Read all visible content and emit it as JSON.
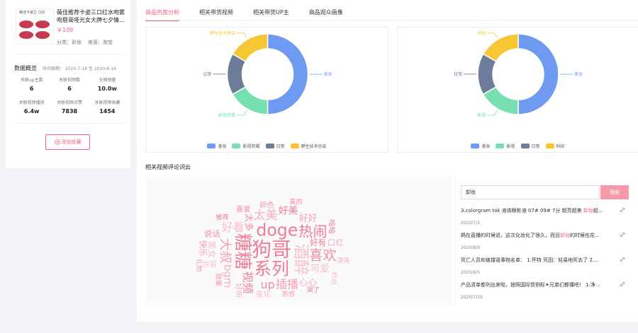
{
  "product": {
    "title": "薇佳推荐卡姿三口红水吻雾吻唇膏哑光女大牌七夕情…",
    "price": "￥109",
    "category_label": "分类：",
    "category": "彩妆",
    "source_label": "来源：",
    "source": "淘宝",
    "thumb_caption": "薇佳卡姿兰 口红"
  },
  "stats": {
    "title": "数据概览",
    "range_label": "时间周期：",
    "range_start": "2020-7-18",
    "range_sep": "至",
    "range_end": "2020-8-16",
    "items": [
      {
        "label": "关联up主数",
        "value": "6"
      },
      {
        "label": "关联视频数",
        "value": "6"
      },
      {
        "label": "全网销量",
        "value": "10.0w"
      },
      {
        "label": "关联视频播放",
        "value": "6.4w"
      },
      {
        "label": "关联视频点赞",
        "value": "7838"
      },
      {
        "label": "关联视频收藏",
        "value": "1454"
      }
    ]
  },
  "favorite_button": {
    "icon": "plus-circle-icon",
    "label": "添加收藏"
  },
  "tabs": [
    {
      "label": "商品热度分析",
      "active": true
    },
    {
      "label": "相关带货视频",
      "active": false
    },
    {
      "label": "相关带货UP主",
      "active": false
    },
    {
      "label": "商品观众画像",
      "active": false
    }
  ],
  "charts": [
    {
      "type": "donut",
      "slices": [
        {
          "name": "美妆",
          "value": 50,
          "color": "#6e9bf1"
        },
        {
          "name": "影视剪辑",
          "value": 16.7,
          "color": "#78dfb0"
        },
        {
          "name": "日常",
          "value": 16.7,
          "color": "#6d7c99"
        },
        {
          "name": "野生技术协会",
          "value": 16.6,
          "color": "#f7c633"
        }
      ],
      "legend": [
        "美妆",
        "影视剪辑",
        "日常",
        "野生技术协会"
      ]
    },
    {
      "type": "donut",
      "slices": [
        {
          "name": "美妆",
          "value": 50,
          "color": "#6e9bf1"
        },
        {
          "name": "影视",
          "value": 16.7,
          "color": "#78dfb0"
        },
        {
          "name": "日常",
          "value": 16.7,
          "color": "#6d7c99"
        },
        {
          "name": "科技",
          "value": 16.6,
          "color": "#f7c633"
        }
      ],
      "legend": [
        "美妆",
        "影视",
        "日常",
        "科技"
      ]
    }
  ],
  "wordcloud": {
    "title": "相关视频评论词云",
    "color": "#f07d93",
    "words": [
      {
        "text": "狗哥",
        "weight": 10
      },
      {
        "text": "糖糖",
        "weight": 9
      },
      {
        "text": "系列",
        "weight": 8.5
      },
      {
        "text": "doge",
        "weight": 8
      },
      {
        "text": "酒醉",
        "weight": 7.5
      },
      {
        "text": "热闹",
        "weight": 6.5
      },
      {
        "text": "喜欢",
        "weight": 6
      },
      {
        "text": "大叔",
        "weight": 5.5
      },
      {
        "text": "太美",
        "weight": 5
      },
      {
        "text": "好看",
        "weight": 4.5
      },
      {
        "text": "视频",
        "weight": 4.5
      },
      {
        "text": "up",
        "weight": 4.5
      },
      {
        "text": "插播",
        "weight": 4.5
      },
      {
        "text": "bgm",
        "weight": 4
      },
      {
        "text": "可爱",
        "weight": 3.5
      },
      {
        "text": "好美",
        "weight": 3.5
      },
      {
        "text": "太多",
        "weight": 3
      },
      {
        "text": "好好",
        "weight": 3
      },
      {
        "text": "心心",
        "weight": 3
      },
      {
        "text": "美女",
        "weight": 3
      },
      {
        "text": "好有",
        "weight": 2.5
      },
      {
        "text": "说话",
        "weight": 2.5
      },
      {
        "text": "快乐",
        "weight": 2.5
      },
      {
        "text": "口红",
        "weight": 2.5
      },
      {
        "text": "妆容",
        "weight": 2
      },
      {
        "text": "哈哈",
        "weight": 2
      },
      {
        "text": "喜爱",
        "weight": 2
      },
      {
        "text": "颜色",
        "weight": 2
      },
      {
        "text": "好听",
        "weight": 2
      },
      {
        "text": "变化",
        "weight": 2
      },
      {
        "text": "推荐",
        "weight": 1.5
      },
      {
        "text": "效果",
        "weight": 1.5
      },
      {
        "text": "质感",
        "weight": 1.5
      },
      {
        "text": "漂亮",
        "weight": 1.5
      },
      {
        "text": "粉丝",
        "weight": 1.5
      },
      {
        "text": "哭了",
        "weight": 1.5
      },
      {
        "text": "真的",
        "weight": 1.5
      },
      {
        "text": "礼物",
        "weight": 1.5
      }
    ]
  },
  "search": {
    "value": "卸妆",
    "button_label": "搜索"
  },
  "comments": [
    {
      "pre": "3.colorgram tok 液体眼影液 07# 09# 7分 超亮超美 ",
      "hl": "卸妆",
      "post": "超…",
      "date": "2020/7/2"
    },
    {
      "pre": "鹈在直播的时候说，这次化妆化了很久，而且",
      "hl": "卸妆",
      "post": "的时候也花…",
      "date": "2020/8/9"
    },
    {
      "pre": "死亡人员和被撞毁事物名单： 1.怀特 死因：轻易地死去了 2.…",
      "hl": "",
      "post": "",
      "date": "2020/8/5"
    },
    {
      "pre": "产品清单都列出来啦，按照国际惯例标✦兄弟们都懂吧！ 1:净…",
      "hl": "",
      "post": "",
      "date": "2020/7/19"
    }
  ]
}
